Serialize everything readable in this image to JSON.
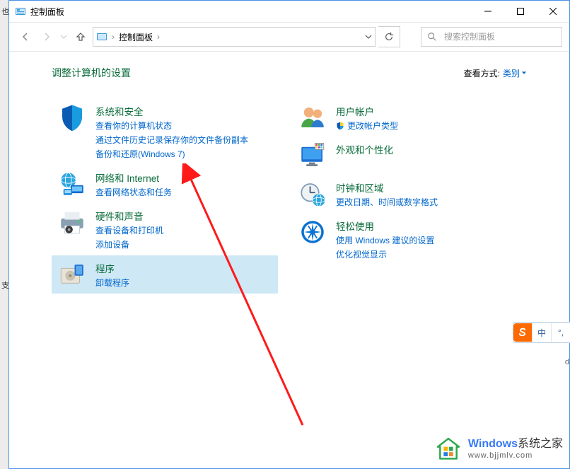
{
  "window": {
    "title": "控制面板"
  },
  "toolbar": {
    "breadcrumb_root": "控制面板"
  },
  "search": {
    "placeholder": "搜索控制面板"
  },
  "content": {
    "heading": "调整计算机的设置",
    "view_label": "查看方式:",
    "view_value": "类别"
  },
  "categories": {
    "left": [
      {
        "title": "系统和安全",
        "links": [
          "查看你的计算机状态",
          "通过文件历史记录保存你的文件备份副本",
          "备份和还原(Windows 7)"
        ]
      },
      {
        "title": "网络和 Internet",
        "links": [
          "查看网络状态和任务"
        ]
      },
      {
        "title": "硬件和声音",
        "links": [
          "查看设备和打印机",
          "添加设备"
        ]
      },
      {
        "title": "程序",
        "links": [
          "卸载程序"
        ]
      }
    ],
    "right": [
      {
        "title": "用户帐户",
        "links": [
          "更改帐户类型"
        ],
        "shield": true
      },
      {
        "title": "外观和个性化",
        "links": []
      },
      {
        "title": "时钟和区域",
        "links": [
          "更改日期、时间或数字格式"
        ]
      },
      {
        "title": "轻松使用",
        "links": [
          "使用 Windows 建议的设置",
          "优化视觉显示"
        ]
      }
    ]
  },
  "ime": {
    "mode": "中"
  },
  "watermark": {
    "brand_prefix": "Windows",
    "brand_suffix": "系统之家",
    "url": "www.bjjmlv.com"
  },
  "edge_letters": {
    "left_top": "也",
    "left_bottom": "支",
    "right": "d"
  }
}
